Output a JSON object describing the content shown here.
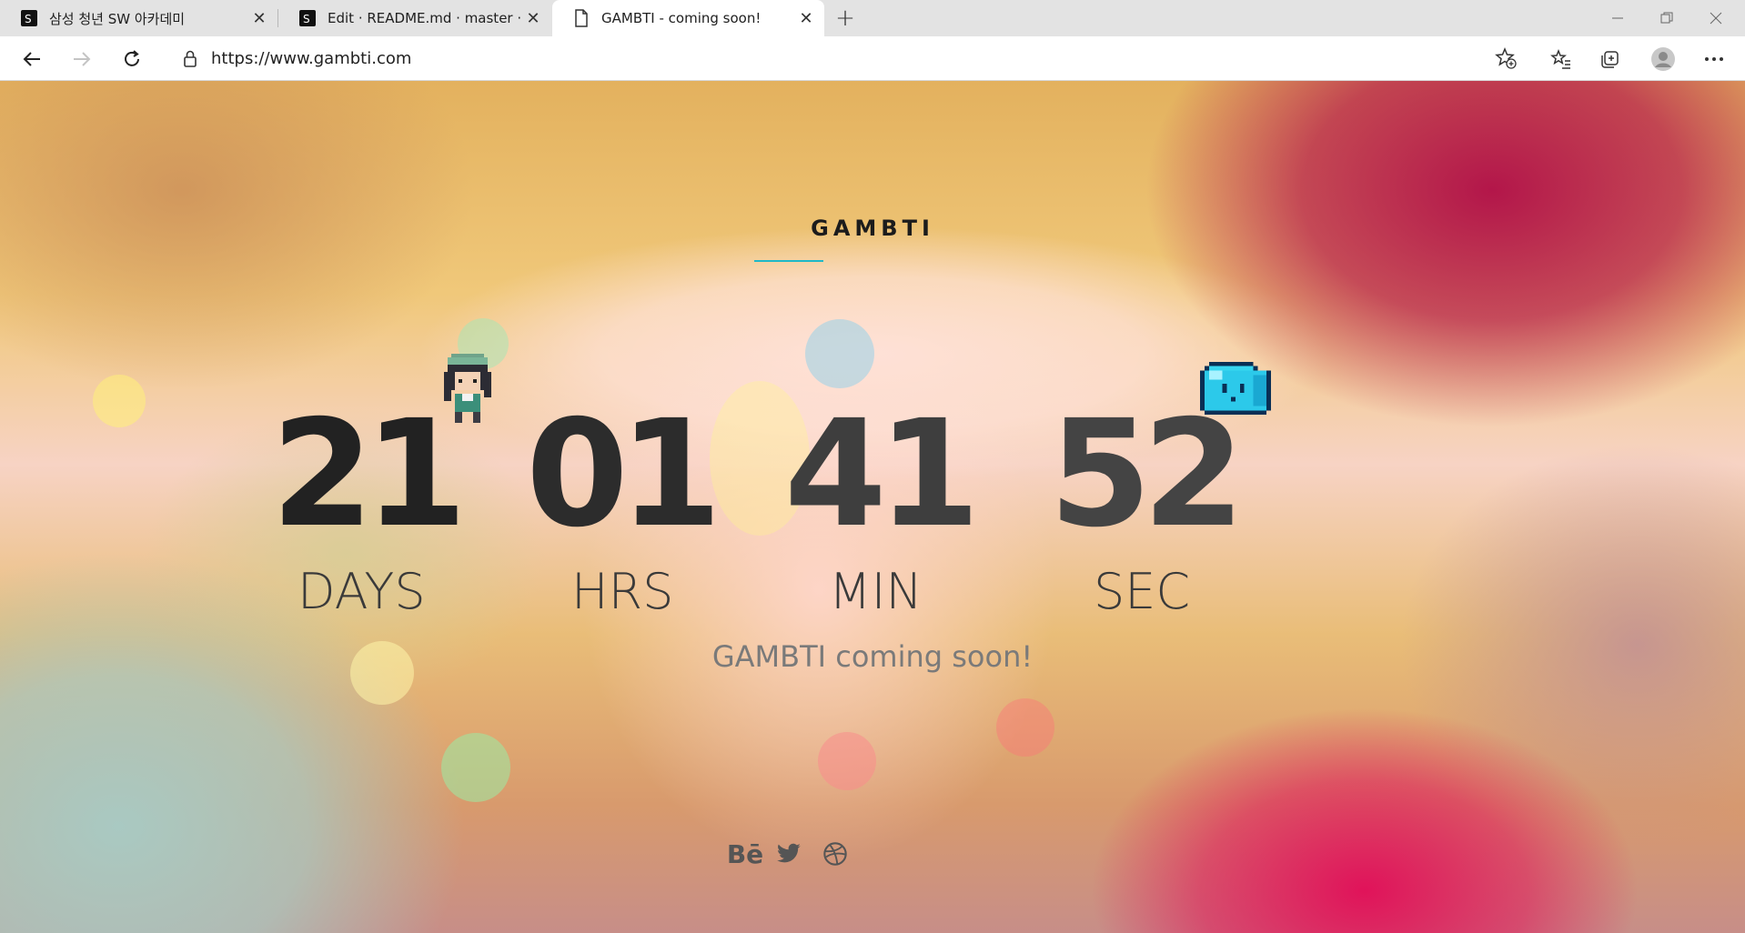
{
  "browser": {
    "tabs": [
      {
        "title": "삼성 청년 SW 아카데미",
        "icon": "ssafy-favicon",
        "active": false
      },
      {
        "title": "Edit · README.md · master · s04-",
        "icon": "gitlab-favicon",
        "active": false
      },
      {
        "title": "GAMBTI - coming soon!",
        "icon": "page-icon",
        "active": true
      }
    ],
    "new_tab_label": "+",
    "url": "https://www.gambti.com"
  },
  "page": {
    "brand": "GAMBTI",
    "countdown": [
      {
        "value": "21",
        "label": "DAYS"
      },
      {
        "value": "01",
        "label": "HRS"
      },
      {
        "value": "41",
        "label": "MIN"
      },
      {
        "value": "52",
        "label": "SEC"
      }
    ],
    "subtitle": "GAMBTI coming soon!",
    "social": {
      "behance_label": "Bē",
      "icons": [
        "behance-icon",
        "twitter-icon",
        "dribbble-icon"
      ]
    },
    "accent_color": "#1fb8c7"
  }
}
